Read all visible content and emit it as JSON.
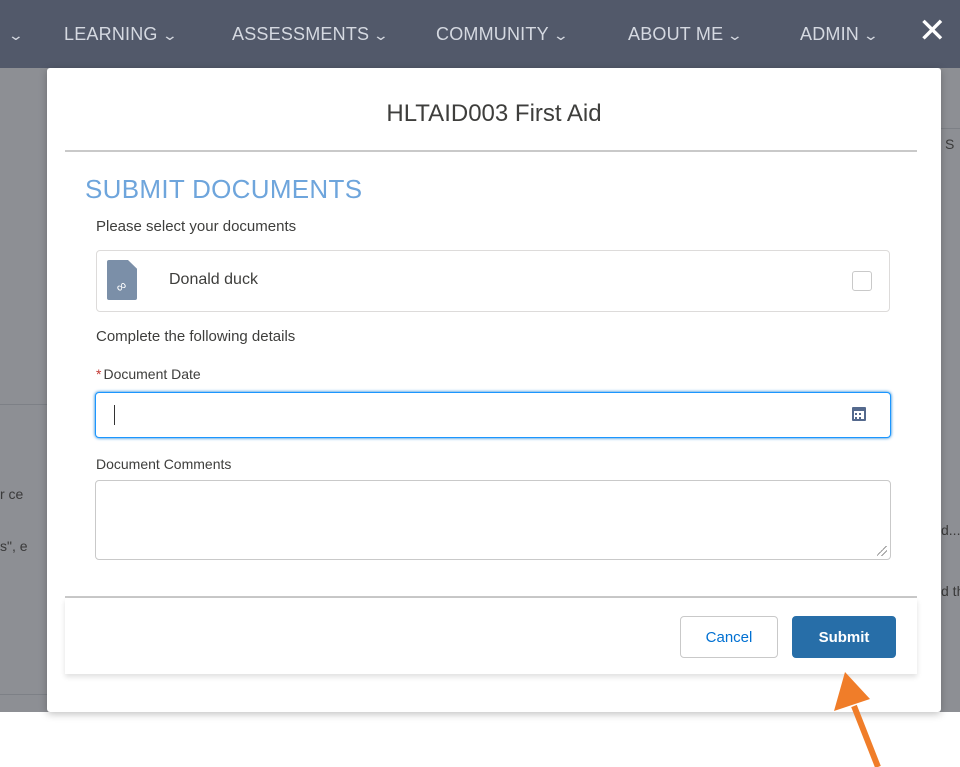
{
  "nav": {
    "items": [
      {
        "label": "LEARNING"
      },
      {
        "label": "ASSESSMENTS"
      },
      {
        "label": "COMMUNITY"
      },
      {
        "label": "ABOUT ME"
      },
      {
        "label": "ADMIN"
      }
    ],
    "chevron": "⌄",
    "close_icon": "✕"
  },
  "background_fragments": [
    "S",
    "r ce",
    "s\", e",
    "d...",
    "d th"
  ],
  "modal": {
    "title": "HLTAID003 First Aid",
    "section_heading": "SUBMIT DOCUMENTS",
    "select_prompt": "Please select your documents",
    "document": {
      "name": "Donald duck",
      "icon": "attachment-icon",
      "selected": false
    },
    "details_prompt": "Complete the following details",
    "date_field": {
      "label": "Document Date",
      "required_mark": "*",
      "value": ""
    },
    "comments_field": {
      "label": "Document Comments",
      "value": ""
    },
    "buttons": {
      "cancel": "Cancel",
      "submit": "Submit"
    }
  },
  "colors": {
    "nav_bg": "#52596a",
    "heading": "#6ea5dc",
    "submit_bg": "#276ea8",
    "annotation_arrow": "#f07d29"
  }
}
